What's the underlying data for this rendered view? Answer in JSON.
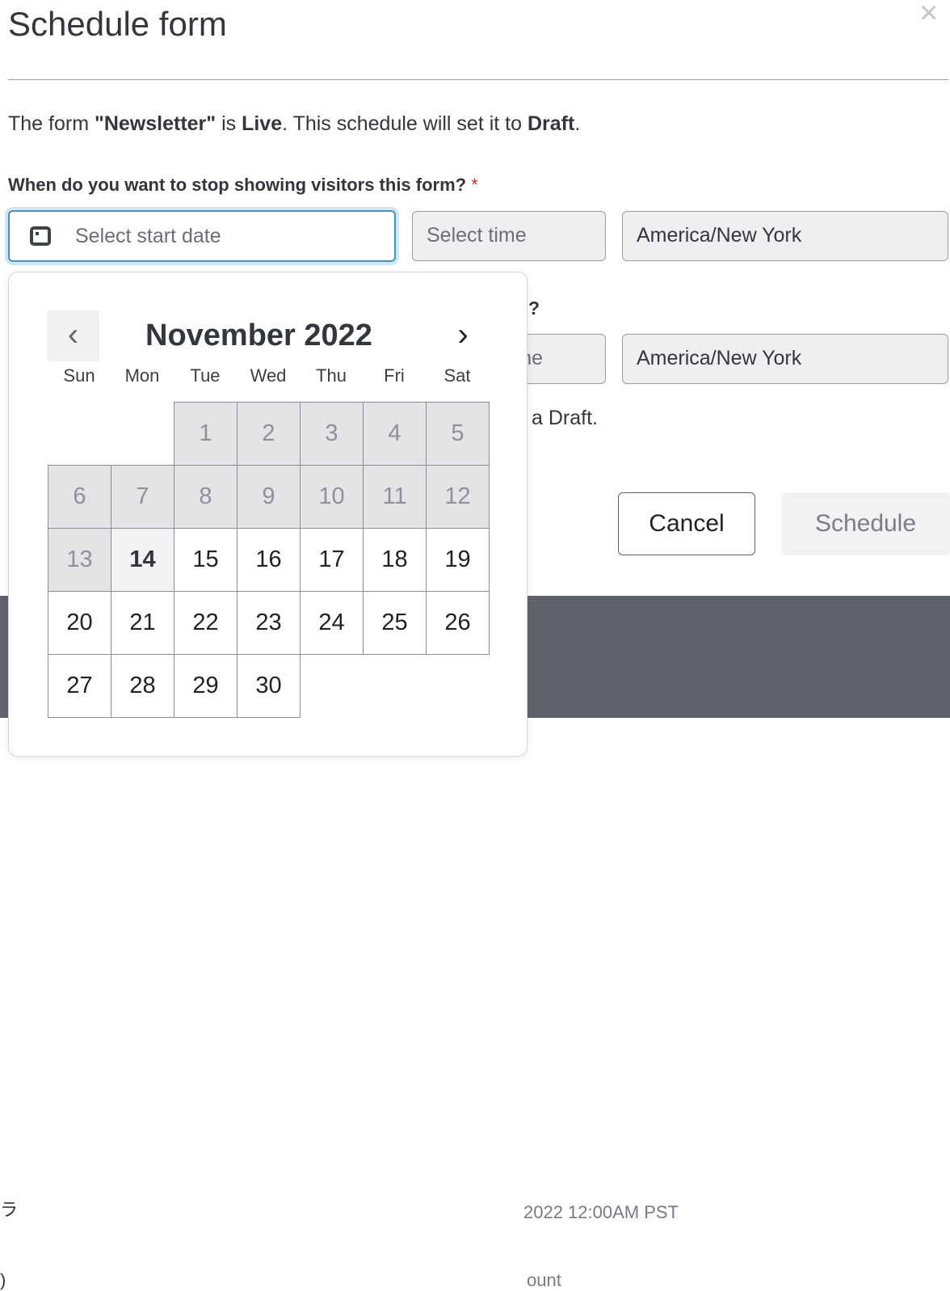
{
  "modal": {
    "title": "Schedule form",
    "close_icon": "close-icon",
    "description": {
      "prefix": "The form ",
      "form_name": "\"Newsletter\"",
      "middle": " is ",
      "status": "Live",
      "middle2": ". This schedule will set it to ",
      "target": "Draft",
      "suffix": "."
    },
    "stop_question": "When do you want to stop showing visitors this form?",
    "required_mark": "*",
    "date_placeholder": "Select start date",
    "time_placeholder": "Select time",
    "timezone": "America/New York",
    "second_question_fragment": "n?",
    "second_time_fragment": "ne",
    "second_timezone": "America/New York",
    "note_fragment_prefix": "a ",
    "note_fragment_bold": "Draft",
    "note_fragment_suffix": ".",
    "cancel_label": "Cancel",
    "schedule_label": "Schedule"
  },
  "background": {
    "text1": "2022 12:00AM PST",
    "text2": "ount",
    "edge1": "ラ",
    "edge2": ")"
  },
  "calendar": {
    "month_label": "November 2022",
    "prev_icon": "chevron-left-icon",
    "next_icon": "chevron-right-icon",
    "weekdays": [
      "Sun",
      "Mon",
      "Tue",
      "Wed",
      "Thu",
      "Fri",
      "Sat"
    ],
    "first_weekday_index": 2,
    "days_in_month": 30,
    "today": 14,
    "disabled_before": 14
  }
}
